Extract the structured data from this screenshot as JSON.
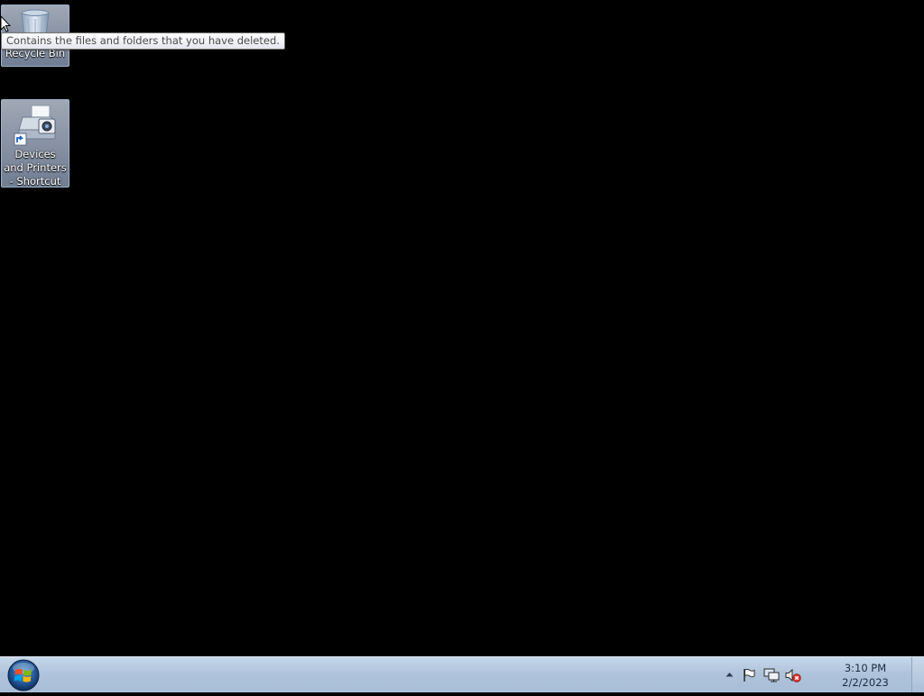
{
  "desktop": {
    "background_color": "#000000",
    "icons": [
      {
        "label": "Recycle Bin",
        "icon": "recycle-bin-icon"
      },
      {
        "label": "Devices and Printers - Shortcut",
        "icon": "devices-and-printers-icon"
      }
    ],
    "tooltip": "Contains the files and folders that you have deleted."
  },
  "taskbar": {
    "start_button_icon": "windows-logo-icon",
    "tray": {
      "icons": [
        "show-hidden-icons-chevron-icon",
        "action-center-flag-icon",
        "network-icon",
        "volume-muted-icon"
      ]
    },
    "clock": {
      "time": "3:10 PM",
      "date": "2/2/2023"
    }
  }
}
